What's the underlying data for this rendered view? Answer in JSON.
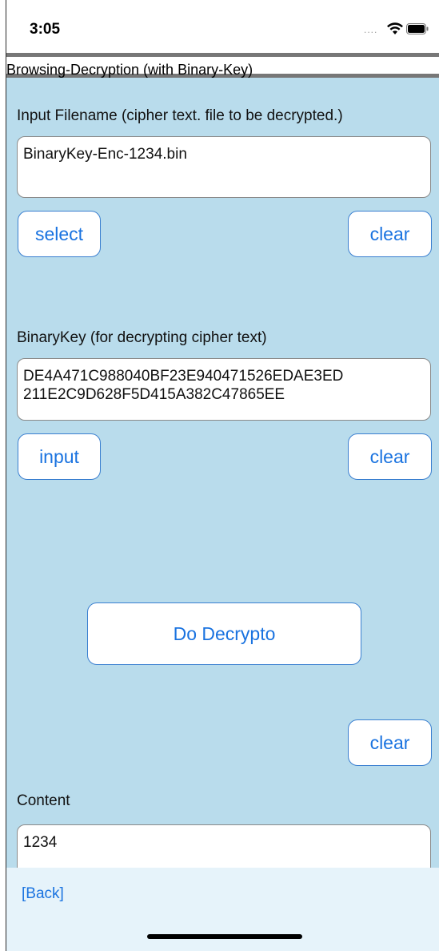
{
  "status": {
    "time": "3:05",
    "signal": "...."
  },
  "title": "Browsing-Decryption (with Binary-Key)",
  "input_section": {
    "label": "Input Filename (cipher text. file to be decrypted.)",
    "value": "BinaryKey-Enc-1234.bin",
    "select_label": "select",
    "clear_label": "clear"
  },
  "key_section": {
    "label": "BinaryKey (for decrypting cipher text)",
    "value_line1": "DE4A471C988040BF23E940471526EDAE3ED",
    "value_line2": "211E2C9D628F5D415A382C47865EE",
    "input_label": "input",
    "clear_label": "clear"
  },
  "decrypt_button": "Do Decrypto",
  "content_section": {
    "clear_label": "clear",
    "label": "Content",
    "value": "1234"
  },
  "footer": {
    "back_label": "[Back]"
  },
  "colors": {
    "panel_bg": "#b9dcec",
    "accent": "#1a73e0",
    "footer_bg": "#e6f3fa"
  }
}
